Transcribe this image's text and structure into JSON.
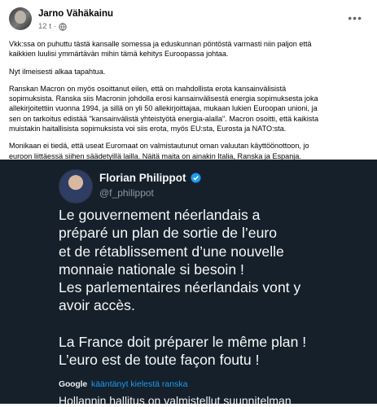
{
  "post": {
    "author": "Jarno Vähäkainu",
    "time": "12 t",
    "paragraphs": [
      [
        "Vkk:ssa on puhuttu tästä kansalle somessa ja eduskunnan pöntöstä varmasti niin paljon että",
        "kaikkien luulisi ymmärtävän mihin tämä kehitys Euroopassa johtaa."
      ],
      [
        "Nyt ilmeisesti alkaa tapahtua."
      ],
      [
        "Ranskan Macron on myös osoittanut eilen, että on mahdollista erota kansainvälisistä",
        "sopimuksista. Ranska siis Macronin johdolla erosi  kansainvälisestä energia sopimuksesta joka",
        "allekirjoitettiin vuonna 1994, ja sillä on yli 50 allekirjoittajaa, mukaan lukien Euroopan unioni, ja",
        "sen on tarkoitus edistää \"kansainvälistä yhteistyötä energia-alalla\". Macron osoitti, että kaikista",
        "muistakin haitallisista sopimuksista voi siis erota, myös EU:sta, Eurosta ja NATO:sta."
      ],
      [
        "Monikaan ei tiedä, että useat Euromaat on valmistautunut oman valuutan käyttöönottoon, jo",
        "euroon liittäessä siihen säädetyillä lailla. Näitä maita on ainakin Italia, Ranska ja Espanja."
      ]
    ]
  },
  "tweet": {
    "name": "Florian Philippot",
    "handle": "@f_philippot",
    "lines_1": [
      "Le gouvernement néerlandais a",
      "préparé un plan de sortie de l’euro",
      "et de rétablissement d’une nouvelle",
      "monnaie nationale si besoin !",
      "Les parlementaires néerlandais vont y",
      "avoir accès."
    ],
    "lines_2": [
      "La France doit préparer le même plan !",
      "L’euro est de toute façon foutu !"
    ],
    "google": "Google",
    "translate_label": "kääntänyt kielestä ranska",
    "translation_partial": "Hollannin hallitus on valmistellut suunnitelman"
  },
  "colors": {
    "tweet_bg": "#15202b",
    "link": "#1d9bf0",
    "verified": "#1d9bf0"
  }
}
